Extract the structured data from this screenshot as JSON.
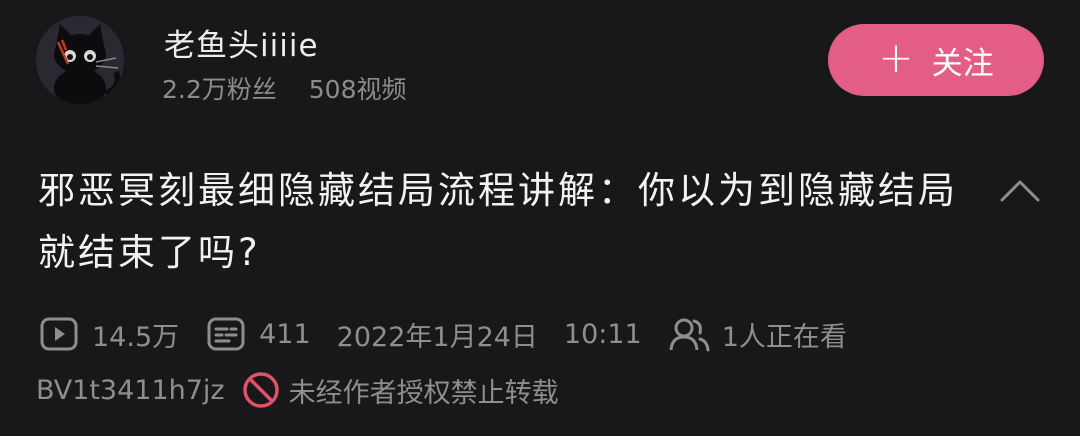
{
  "uploader": {
    "name": "老鱼头iiiie",
    "followers": "2.2万粉丝",
    "videos": "508视频",
    "follow_label": "关注",
    "avatar_icon": "black-cat-avatar"
  },
  "video": {
    "title": "邪恶冥刻最细隐藏结局流程讲解：你以为到隐藏结局就结束了吗?",
    "views": "14.5万",
    "danmaku": "411",
    "date": "2022年1月24日",
    "time": "10:11",
    "watching": "1人正在看",
    "bvid": "BV1t3411h7jz",
    "copyright": "未经作者授权禁止转载"
  },
  "colors": {
    "background": "#18181a",
    "accent": "#e35d87",
    "ban_red": "#e05266",
    "muted_text": "#8e8e91"
  },
  "icons": [
    "play-icon",
    "danmaku-icon",
    "viewers-icon",
    "no-repost-icon",
    "chevron-up-icon"
  ]
}
